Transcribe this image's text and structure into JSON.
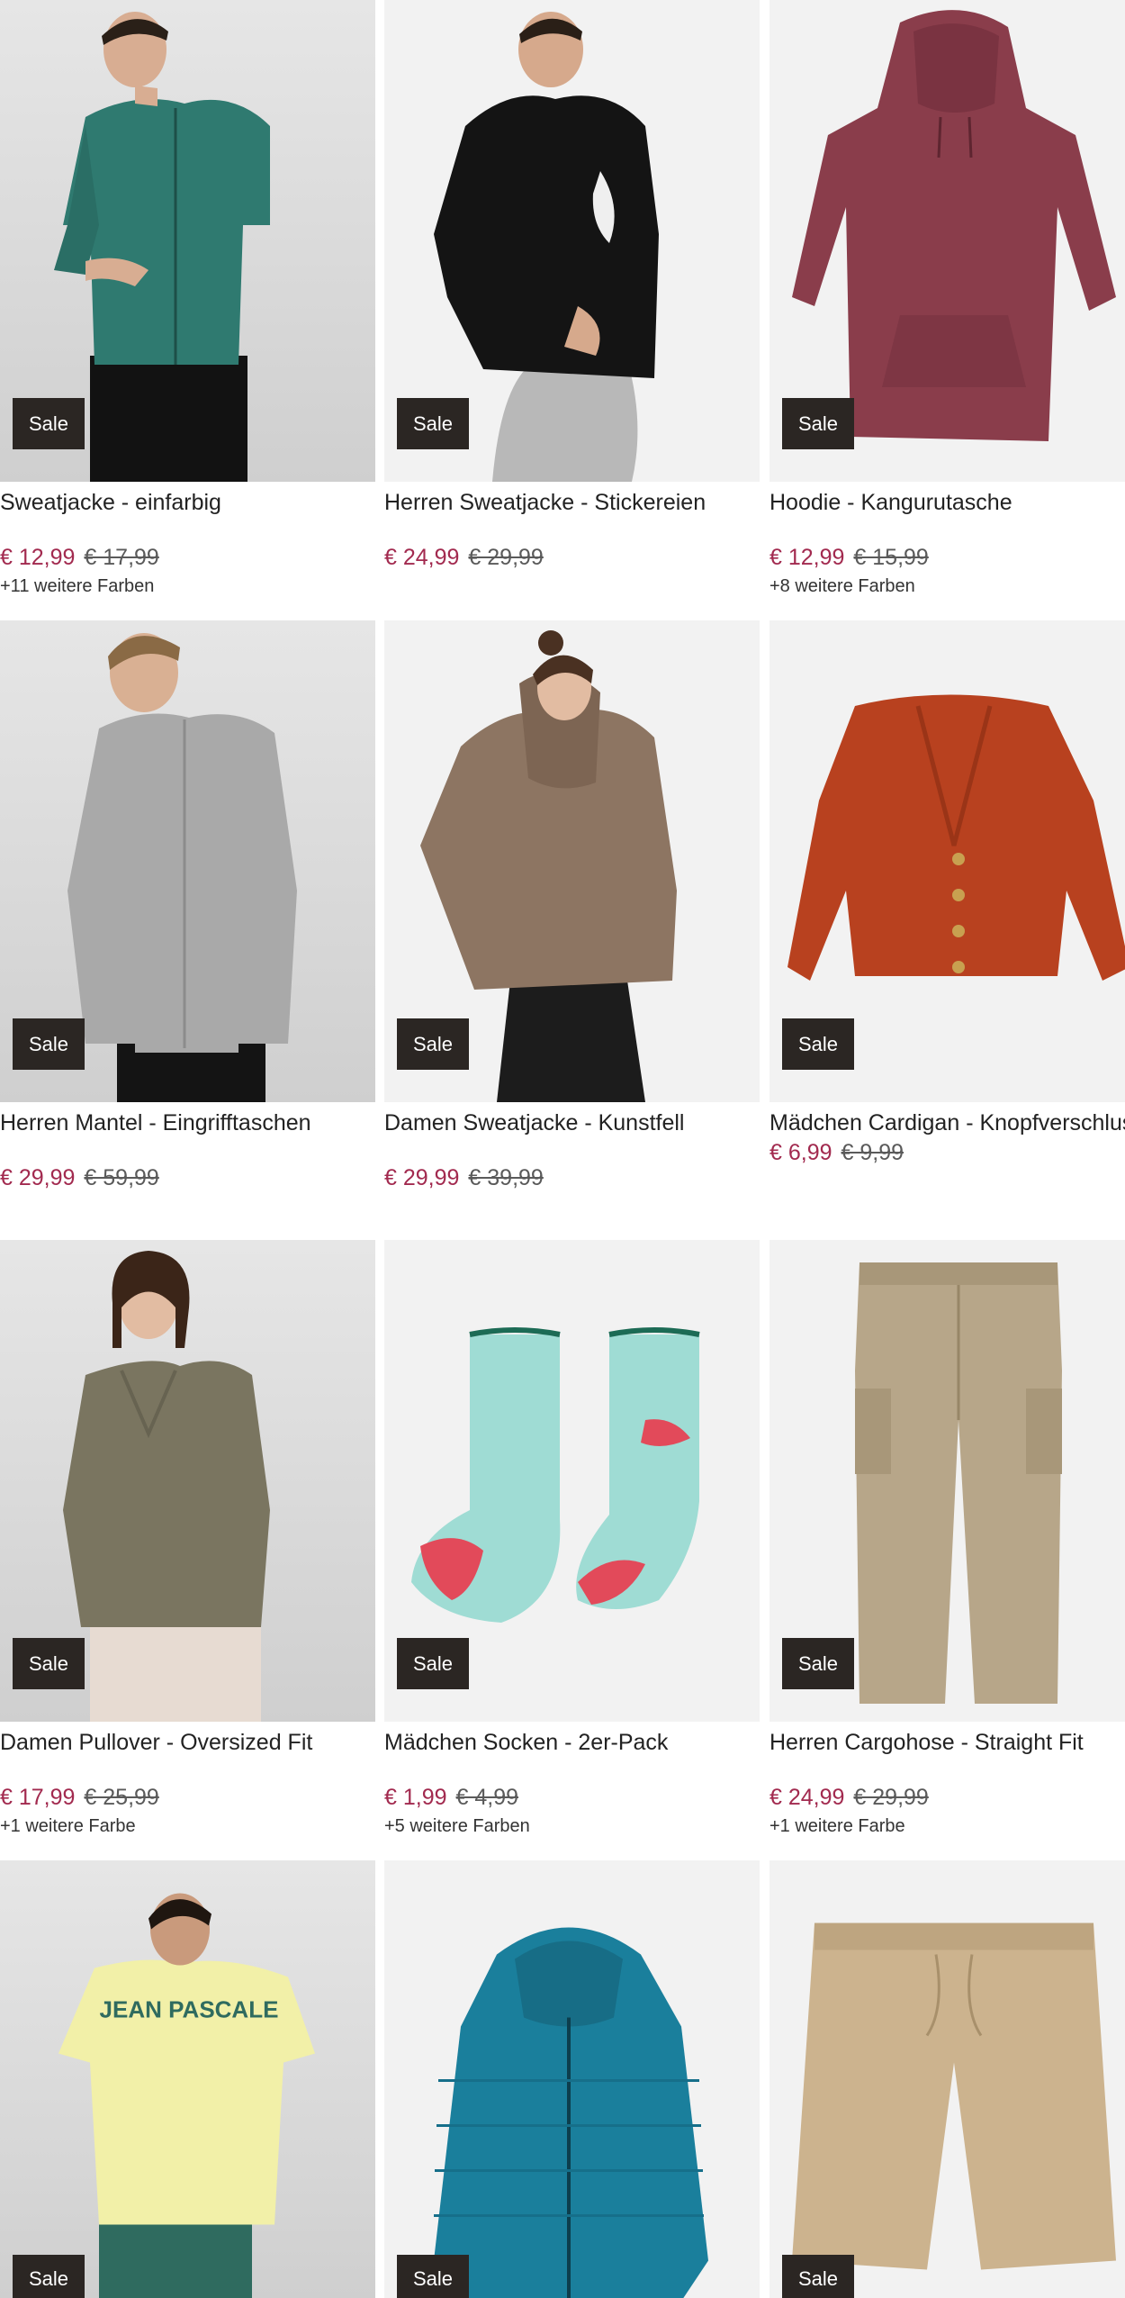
{
  "badge_label": "Sale",
  "currency": "€",
  "products": [
    {
      "title": "Sweatjacke - einfarbig",
      "price": "€ 12,99",
      "old_price": "€ 17,99",
      "colors_note": "+11 weitere Farben",
      "badge": "Sale",
      "image": "man-green-zip-hoodie"
    },
    {
      "title": "Herren Sweatjacke - Stickereien",
      "price": "€ 24,99",
      "old_price": "€ 29,99",
      "colors_note": "",
      "badge": "Sale",
      "image": "man-black-hoodie"
    },
    {
      "title": "Hoodie - Kangurutasche",
      "price": "€ 12,99",
      "old_price": "€ 15,99",
      "colors_note": "+8 weitere Farben",
      "badge": "Sale",
      "image": "burgundy-hoodie"
    },
    {
      "title": "Herren Mantel - Eingrifftaschen",
      "price": "€ 29,99",
      "old_price": "€ 59,99",
      "colors_note": "",
      "badge": "Sale",
      "image": "man-grey-coat"
    },
    {
      "title": "Damen Sweatjacke - Kunstfell",
      "price": "€ 29,99",
      "old_price": "€ 39,99",
      "colors_note": "",
      "badge": "Sale",
      "image": "woman-brown-fur-jacket"
    },
    {
      "title": "Mädchen Cardigan - Knopfverschluss",
      "price": "€ 6,99",
      "old_price": "€ 9,99",
      "colors_note": "",
      "badge": "Sale",
      "image": "orange-cardigan"
    },
    {
      "title": "Damen Pullover - Oversized Fit",
      "price": "€ 17,99",
      "old_price": "€ 25,99",
      "colors_note": "+1 weitere Farbe",
      "badge": "Sale",
      "image": "woman-khaki-sweater"
    },
    {
      "title": "Mädchen Socken - 2er-Pack",
      "price": "€ 1,99",
      "old_price": "€ 4,99",
      "colors_note": "+5 weitere Farben",
      "badge": "Sale",
      "image": "watermelon-socks"
    },
    {
      "title": "Herren Cargohose - Straight Fit",
      "price": "€ 24,99",
      "old_price": "€ 29,99",
      "colors_note": "+1 weitere Farbe",
      "badge": "Sale",
      "image": "beige-cargo-pants"
    },
    {
      "title": "",
      "price": "",
      "old_price": "",
      "colors_note": "",
      "badge": "Sale",
      "image": "man-yellow-tshirt",
      "print_text": "JEAN PASCALE"
    },
    {
      "title": "",
      "price": "",
      "old_price": "",
      "colors_note": "",
      "badge": "Sale",
      "image": "blue-puffer-jacket"
    },
    {
      "title": "",
      "price": "",
      "old_price": "",
      "colors_note": "",
      "badge": "Sale",
      "image": "beige-shorts"
    }
  ],
  "colors": {
    "sale_price": "#a22a4f",
    "badge_bg": "#2b2623",
    "text": "#222222"
  }
}
